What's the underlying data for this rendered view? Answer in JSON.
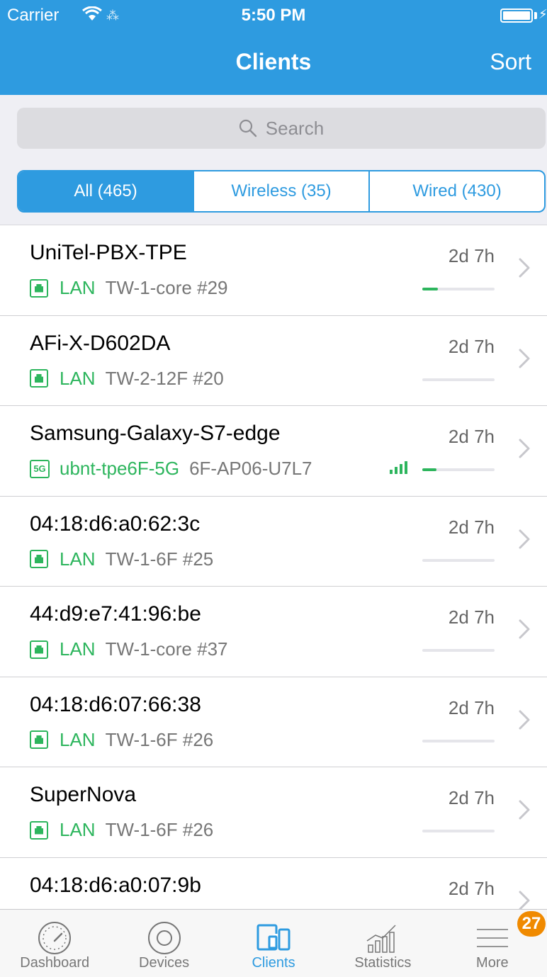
{
  "status_bar": {
    "carrier": "Carrier",
    "time": "5:50 PM"
  },
  "nav": {
    "title": "Clients",
    "sort_label": "Sort"
  },
  "search": {
    "placeholder": "Search"
  },
  "segments": [
    {
      "label": "All (465)",
      "active": true
    },
    {
      "label": "Wireless (35)",
      "active": false
    },
    {
      "label": "Wired (430)",
      "active": false
    }
  ],
  "clients": [
    {
      "name": "UniTel-PBX-TPE",
      "type": "lan",
      "network": "LAN",
      "device": "TW-1-core #29",
      "uptime": "2d 7h",
      "activity": 0.22
    },
    {
      "name": "AFi-X-D602DA",
      "type": "lan",
      "network": "LAN",
      "device": "TW-2-12F #20",
      "uptime": "2d 7h",
      "activity": 0
    },
    {
      "name": "Samsung-Galaxy-S7-edge",
      "type": "5g",
      "badge": "5G",
      "network": "ubnt-tpe6F-5G",
      "device": "6F-AP06-U7L7",
      "uptime": "2d 7h",
      "activity": 0.2,
      "signal_bars": 4
    },
    {
      "name": "04:18:d6:a0:62:3c",
      "type": "lan",
      "network": "LAN",
      "device": "TW-1-6F #25",
      "uptime": "2d 7h",
      "activity": 0
    },
    {
      "name": "44:d9:e7:41:96:be",
      "type": "lan",
      "network": "LAN",
      "device": "TW-1-core #37",
      "uptime": "2d 7h",
      "activity": 0
    },
    {
      "name": "04:18:d6:07:66:38",
      "type": "lan",
      "network": "LAN",
      "device": "TW-1-6F #26",
      "uptime": "2d 7h",
      "activity": 0
    },
    {
      "name": "SuperNova",
      "type": "lan",
      "network": "LAN",
      "device": "TW-1-6F #26",
      "uptime": "2d 7h",
      "activity": 0
    },
    {
      "name": "04:18:d6:a0:07:9b",
      "type": "lan",
      "network": "",
      "device": "",
      "uptime": "2d 7h",
      "activity": 0
    }
  ],
  "tabs": [
    {
      "label": "Dashboard",
      "icon": "dashboard-gauge-icon",
      "active": false
    },
    {
      "label": "Devices",
      "icon": "devices-ring-icon",
      "active": false
    },
    {
      "label": "Clients",
      "icon": "clients-devices-icon",
      "active": true
    },
    {
      "label": "Statistics",
      "icon": "statistics-chart-icon",
      "active": false
    },
    {
      "label": "More",
      "icon": "more-menu-icon",
      "active": false,
      "badge": "27"
    }
  ],
  "colors": {
    "accent": "#2E9BE0",
    "online": "#2DB55D",
    "badge": "#F08A00"
  }
}
